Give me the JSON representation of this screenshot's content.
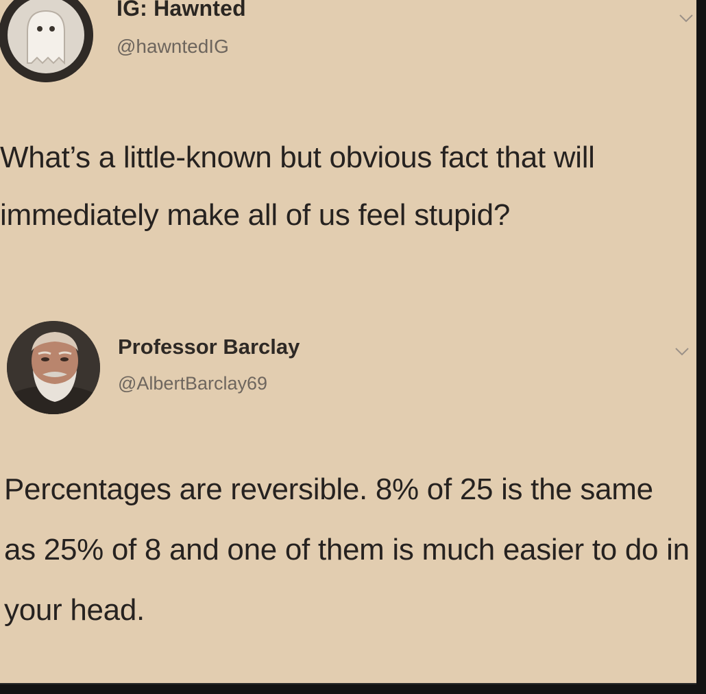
{
  "tweets": [
    {
      "display_name": "IG: Hawnted",
      "handle": "@hawntedIG",
      "avatar_icon": "ghost-icon",
      "text": "What’s a little-known but obvious fact that will immediately make all of us feel stupid?"
    },
    {
      "display_name": "Professor Barclay",
      "handle": "@AlbertBarclay69",
      "avatar_icon": "bearded-man-avatar",
      "text": "Percentages are reversible.  8% of 25 is the same as 25% of 8 and one of them is much easier to do in your head."
    }
  ],
  "icons": {
    "menu_chevron": "chevron-down-icon"
  },
  "colors": {
    "background": "#e2cdb0",
    "text": "#262220",
    "handle_text": "#6d655d"
  }
}
